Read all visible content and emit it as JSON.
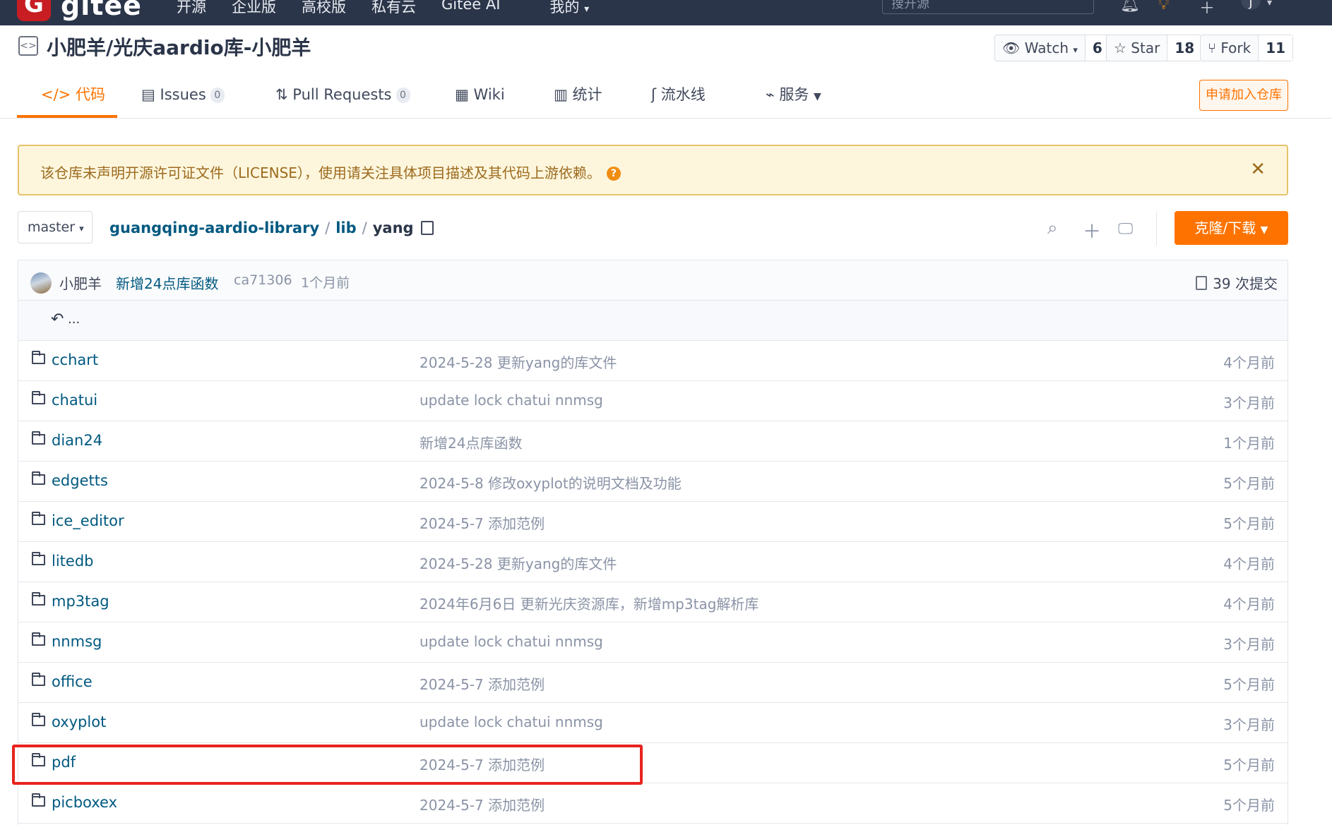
{
  "topnav": {
    "logo_text": "gitee",
    "items": [
      "开源",
      "企业版",
      "高校版",
      "私有云",
      "Gitee AI"
    ],
    "mine": "我的",
    "search_placeholder": "搜开源",
    "avatar_letter": "J"
  },
  "repo": {
    "title": "小肥羊/光庆aardio库-小肥羊",
    "watch_label": "Watch",
    "watch_count": "6",
    "star_label": "Star",
    "star_count": "18",
    "fork_label": "Fork",
    "fork_count": "11"
  },
  "tabs": [
    {
      "label": "代码",
      "icon": "code-icon"
    },
    {
      "label": "Issues",
      "badge": "0",
      "icon": "issues-icon"
    },
    {
      "label": "Pull Requests",
      "badge": "0",
      "icon": "pull-request-icon"
    },
    {
      "label": "Wiki",
      "icon": "wiki-icon"
    },
    {
      "label": "统计",
      "icon": "stats-icon"
    },
    {
      "label": "流水线",
      "icon": "pipeline-icon"
    },
    {
      "label": "服务",
      "icon": "service-icon"
    }
  ],
  "apply_button": "申请加入仓库",
  "license_warning": "该仓库未声明开源许可证文件（LICENSE），使用请关注具体项目描述及其代码上游依赖。",
  "branch": "master",
  "breadcrumb": {
    "root": "guangqing-aardio-library",
    "sub": "lib",
    "current": "yang"
  },
  "clone_button": "克隆/下载",
  "last_commit": {
    "author": "小肥羊",
    "message": "新增24点库函数",
    "hash": "ca71306",
    "time": "1个月前",
    "commit_count": "39 次提交"
  },
  "parent_dir": "...",
  "files": [
    {
      "name": "cchart",
      "message": "2024-5-28 更新yang的库文件",
      "time": "4个月前"
    },
    {
      "name": "chatui",
      "message": "update lock chatui nnmsg",
      "time": "3个月前"
    },
    {
      "name": "dian24",
      "message": "新增24点库函数",
      "time": "1个月前"
    },
    {
      "name": "edgetts",
      "message": "2024-5-8 修改oxyplot的说明文档及功能",
      "time": "5个月前"
    },
    {
      "name": "ice_editor",
      "message": "2024-5-7 添加范例",
      "time": "5个月前"
    },
    {
      "name": "litedb",
      "message": "2024-5-28 更新yang的库文件",
      "time": "4个月前"
    },
    {
      "name": "mp3tag",
      "message": "2024年6月6日 更新光庆资源库，新增mp3tag解析库",
      "time": "4个月前"
    },
    {
      "name": "nnmsg",
      "message": "update lock chatui nnmsg",
      "time": "3个月前"
    },
    {
      "name": "office",
      "message": "2024-5-7 添加范例",
      "time": "5个月前"
    },
    {
      "name": "oxyplot",
      "message": "update lock chatui nnmsg",
      "time": "3个月前"
    },
    {
      "name": "pdf",
      "message": "2024-5-7 添加范例",
      "time": "5个月前"
    },
    {
      "name": "picboxex",
      "message": "2024-5-7 添加范例",
      "time": "5个月前"
    }
  ],
  "colors": {
    "accent": "#fe7300",
    "navbar": "#2b3549",
    "link": "#005980",
    "highlight_box": "#e8231f"
  }
}
